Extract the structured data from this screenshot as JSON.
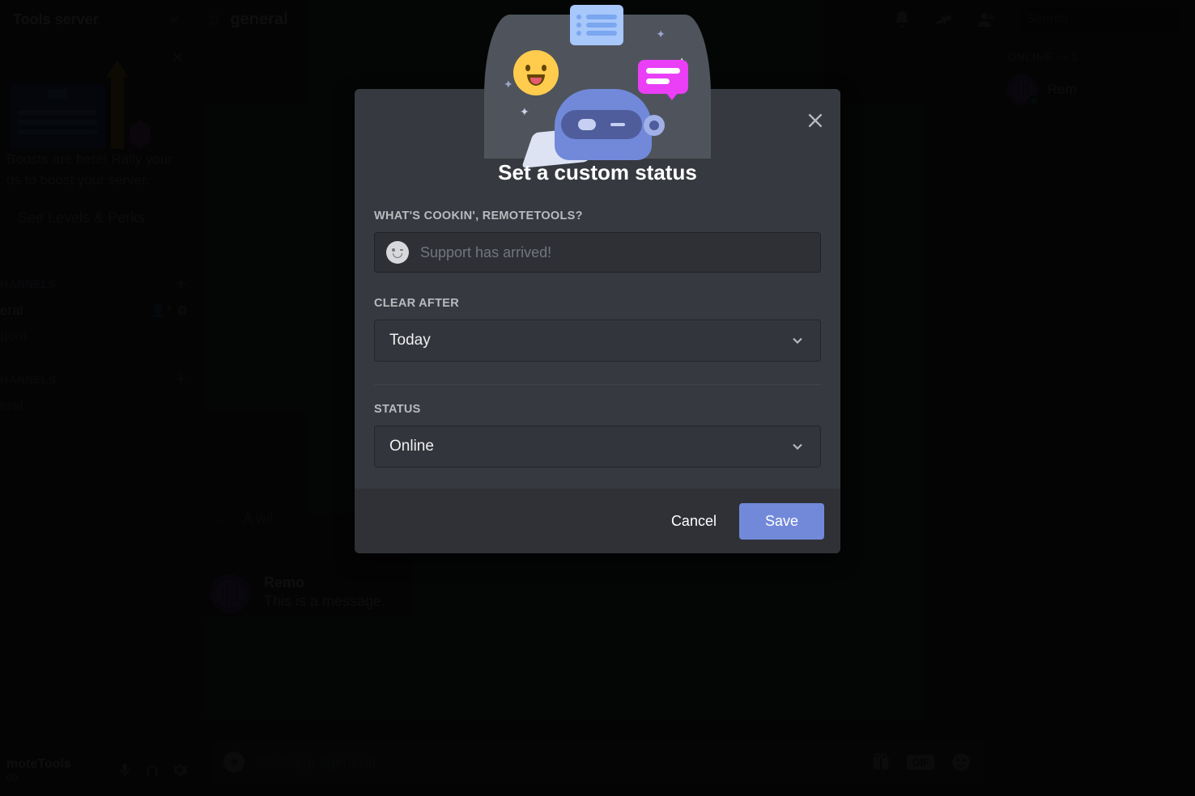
{
  "server": {
    "name": "Tools server"
  },
  "promo": {
    "text_line1": "Boosts are here! Rally your",
    "text_line2": "ds to boost your server.",
    "button": "See Levels & Perks"
  },
  "channels": {
    "section_text_label": "HANNELS",
    "section_voice_label": "HANNELS",
    "text_items": [
      "eral",
      "dom"
    ],
    "voice_items": [
      "eral"
    ]
  },
  "user_panel": {
    "name": "moteTools",
    "discriminator": "09"
  },
  "channel_header": {
    "name": "general",
    "search_placeholder": "Search"
  },
  "messages": {
    "system_text": "A wil",
    "normal_user": "Remo",
    "normal_text": "This is a message."
  },
  "input": {
    "placeholder": "Message #general",
    "gif": "GIF"
  },
  "members": {
    "label": "ONLINE — 1",
    "item_name": "Rem"
  },
  "modal": {
    "title": "Set a custom status",
    "label_status_text": "WHAT'S COOKIN', REMOTETOOLS?",
    "placeholder": "Support has arrived!",
    "label_clear": "CLEAR AFTER",
    "clear_value": "Today",
    "label_presence": "STATUS",
    "presence_value": "Online",
    "cancel": "Cancel",
    "save": "Save"
  }
}
